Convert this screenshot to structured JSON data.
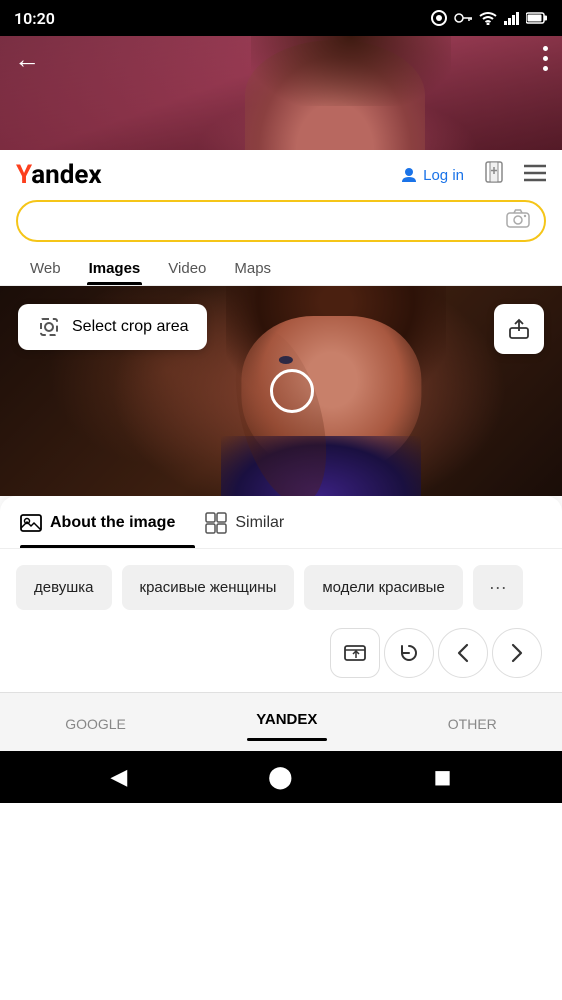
{
  "status_bar": {
    "time": "10:20",
    "icons": [
      "circle-icon",
      "key-icon",
      "wifi-icon",
      "signal-icon",
      "battery-icon"
    ]
  },
  "header": {
    "logo_prefix": "Y",
    "logo_text": "andex",
    "login_label": "Log in",
    "back_label": "←"
  },
  "search": {
    "placeholder": ""
  },
  "nav_tabs": [
    {
      "label": "Web",
      "active": false
    },
    {
      "label": "Images",
      "active": true
    },
    {
      "label": "Video",
      "active": false
    },
    {
      "label": "Maps",
      "active": false
    }
  ],
  "image_viewer": {
    "crop_btn_label": "Select crop area",
    "share_btn_label": "↑"
  },
  "panel_tabs": [
    {
      "label": "About the image",
      "active": true,
      "icon": "image-icon"
    },
    {
      "label": "Similar",
      "active": false,
      "icon": "grid-icon"
    }
  ],
  "tags": [
    {
      "label": "девушка"
    },
    {
      "label": "красивые женщины"
    },
    {
      "label": "модели красивые"
    },
    {
      "label": "···"
    }
  ],
  "toolbar": {
    "upload_icon": "⬆",
    "refresh_icon": "↺",
    "prev_icon": "‹",
    "next_icon": "›"
  },
  "engines": [
    {
      "label": "GOOGLE",
      "active": false
    },
    {
      "label": "YANDEX",
      "active": true
    },
    {
      "label": "OTHER",
      "active": false
    }
  ],
  "sys_nav": {
    "back_icon": "◀",
    "home_icon": "⬤",
    "recent_icon": "◼"
  }
}
